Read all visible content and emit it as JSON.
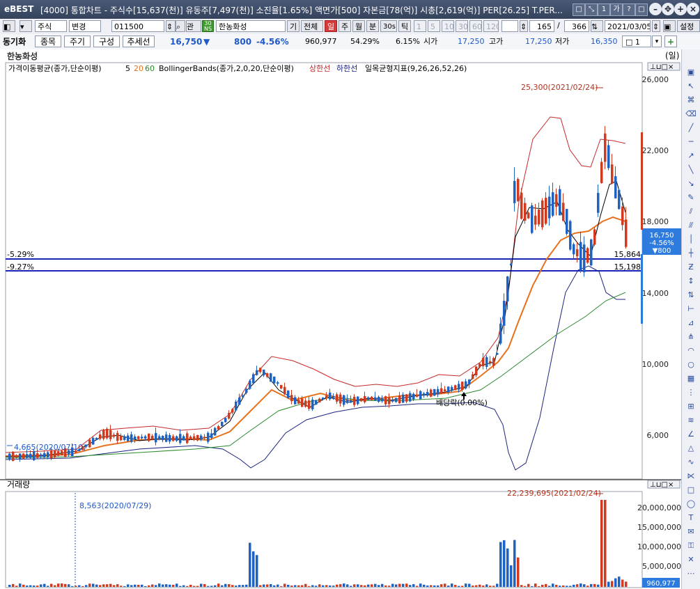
{
  "titlebar": {
    "logo": "eBEST",
    "title": "[4000] 통합차트 - 주식수[15,637(천)] 유동주[7,497(천)] 소진율[1.65%] 액면가[500] 자본금[78(억)] 시총[2,619(억)] PER[26.25] T.PER..."
  },
  "toolbar": {
    "market": "주식",
    "change": "변경",
    "code": "011500",
    "rel_btn": "관",
    "name": "한농화성",
    "btn_gi": "기",
    "btn_all": "전체",
    "period_buttons": [
      "일",
      "주",
      "월",
      "분",
      "30s",
      "틱"
    ],
    "num_buttons": [
      "1",
      "5",
      "10",
      "30",
      "60",
      "120"
    ],
    "count": "165",
    "total": "366",
    "date": "2021/03/05",
    "settings": "설정"
  },
  "infobar": {
    "sync": "동기화",
    "btn_stock": "종목",
    "btn_cycle": "주기",
    "btn_compose": "구성",
    "btn_trend": "추세선",
    "price": "16,750",
    "change_arrow": "▼",
    "change": "800",
    "change_pct": "-4.56%",
    "volume": "960,977",
    "pct1": "54.29%",
    "pct2": "6.15%",
    "open_label": "시가",
    "open": "17,250",
    "high_label": "고가",
    "high": "17,250",
    "low_label": "저가",
    "low": "16,350",
    "spin_value": "1"
  },
  "chart": {
    "stock_name": "한농화성",
    "unit": "(일)",
    "legend": {
      "ma": "가격이동평균(종가,단순이평)",
      "ma_periods": [
        "5",
        "20",
        "60"
      ],
      "bb": "BollingerBands(종가,2,0,20,단순이평)",
      "bb_upper": "상한선",
      "bb_lower": "하한선",
      "ichimoku": "일목균형지표(9,26,26,52,26)"
    },
    "price_axis": [
      "26,000",
      "22,000",
      "18,000",
      "14,000",
      "10,000",
      "6,000"
    ],
    "hlines": [
      {
        "label": "-5.29%",
        "value": "15,864"
      },
      {
        "label": "-9.27%",
        "value": "15,198"
      }
    ],
    "annotations": {
      "max": "25,300(2021/02/24)",
      "min": "4,665(2020/07/10)",
      "dividend": "배당락(0.00%)"
    },
    "current": {
      "price": "16,750",
      "pct": "-4.56%",
      "change": "▼800"
    },
    "colors": {
      "up": "#d03a1e",
      "down": "#1f63c2",
      "ma5": "#000000",
      "ma20": "#e8711c",
      "ma60": "#2b8a2b",
      "bb_upper": "#c62828",
      "bb_lower": "#1a237e",
      "hline": "#1a24b8"
    }
  },
  "volume": {
    "title": "거래량",
    "axis": [
      "20,000,000",
      "15,000,000",
      "10,000,000",
      "5,000,000"
    ],
    "max": "22,239,695(2021/02/24)",
    "marker": "8,563(2020/07/29)",
    "current": "960,977"
  }
}
